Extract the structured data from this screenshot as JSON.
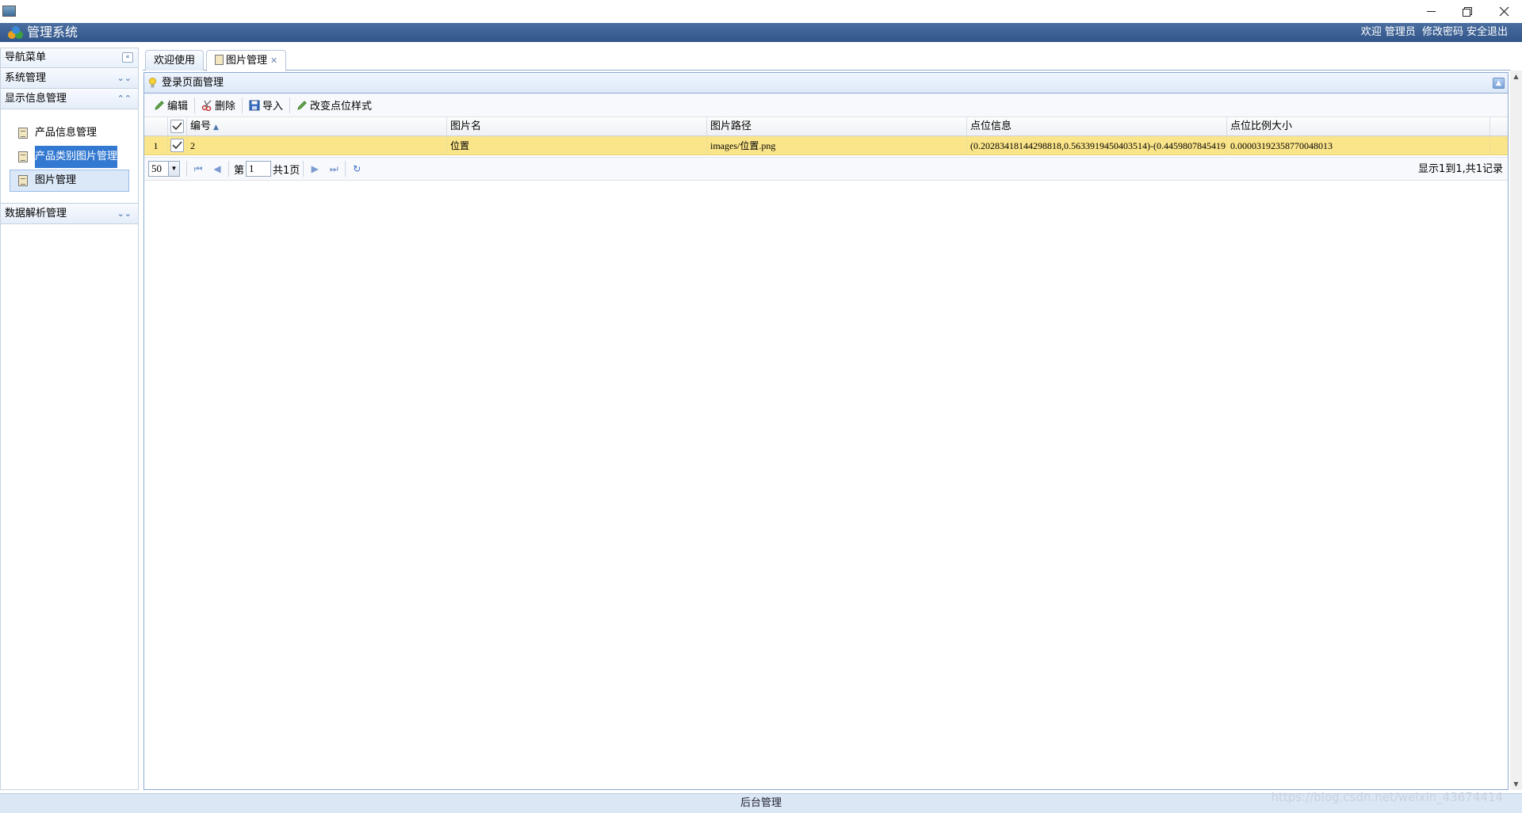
{
  "window": {
    "minimize_glyph": "—",
    "restore_glyph": "❐",
    "close_glyph": "✕"
  },
  "header": {
    "title": "管理系统",
    "welcome": "欢迎",
    "user": "管理员",
    "change_password": "修改密码",
    "logout": "安全退出"
  },
  "sidebar": {
    "title": "导航菜单",
    "sections": [
      {
        "label": "系统管理",
        "expanded": false
      },
      {
        "label": "显示信息管理",
        "expanded": true,
        "items": [
          {
            "label": "产品信息管理"
          },
          {
            "label": "产品类别图片管理"
          },
          {
            "label": "图片管理"
          }
        ]
      },
      {
        "label": "数据解析管理",
        "expanded": false
      }
    ]
  },
  "tabs": [
    {
      "label": "欢迎使用"
    },
    {
      "label": "图片管理",
      "closable": true
    }
  ],
  "panel": {
    "title": "登录页面管理"
  },
  "toolbar": {
    "edit": "编辑",
    "delete": "删除",
    "import": "导入",
    "change_style": "改变点位样式"
  },
  "grid": {
    "columns": [
      "编号",
      "图片名",
      "图片路径",
      "点位信息",
      "点位比例大小"
    ],
    "rows": [
      {
        "row_num": "1",
        "id": "2",
        "name": "位置",
        "path": "images/位置.png",
        "points": "(0.20283418144298818,0.5633919450403514)-(0.4459807845419",
        "scale": "0.00003192358770048013"
      }
    ]
  },
  "pager": {
    "page_size": "50",
    "page_prefix": "第",
    "page_value": "1",
    "page_total": "共1页",
    "info": "显示1到1,共1记录"
  },
  "footer": {
    "text": "后台管理"
  },
  "watermark": "https://blog.csdn.net/weixin_43674414",
  "colors": {
    "header_bg": "#31568a",
    "selected_row": "#fbe58a",
    "highlight": "#3479d1"
  }
}
